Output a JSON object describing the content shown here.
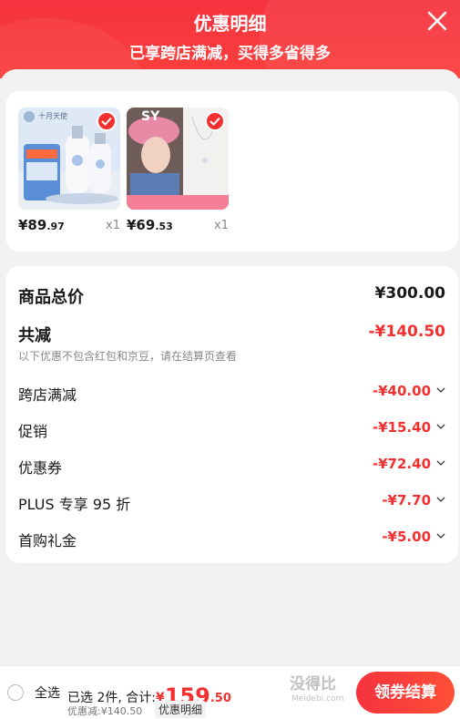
{
  "header": {
    "title": "优惠明细",
    "subtitle": "已享跨店满减，买得多省得多"
  },
  "products": [
    {
      "price_int": "¥89",
      "price_dec": ".97",
      "qty": "x1",
      "image_text": "十月天使"
    },
    {
      "price_int": "¥69",
      "price_dec": ".53",
      "qty": "x1",
      "image_text": "SY"
    }
  ],
  "summary": {
    "total_label": "商品总价",
    "total_value": "¥300.00",
    "reduce_label": "共减",
    "reduce_value": "-¥140.50",
    "note": "以下优惠不包含红包和京豆，请在结算页查看",
    "items": [
      {
        "label": "跨店满减",
        "value": "-¥40.00"
      },
      {
        "label": "促销",
        "value": "-¥15.40"
      },
      {
        "label": "优惠券",
        "value": "-¥72.40"
      },
      {
        "label": "PLUS 专享 95 折",
        "value": "-¥7.70"
      },
      {
        "label": "首购礼金",
        "value": "-¥5.00"
      }
    ]
  },
  "bottom": {
    "select_all": "全选",
    "selected_text": "已选 2件, 合计:",
    "currency": "¥",
    "total_int": "159",
    "total_dec": ".50",
    "reduced_text": "优惠减:¥140.50",
    "detail_tag": "优惠明细",
    "checkout": "领券结算"
  },
  "watermark": {
    "main": "没得比",
    "sub": "Meidebi.com"
  },
  "colors": {
    "accent": "#f23030",
    "header": "#f5333f"
  }
}
